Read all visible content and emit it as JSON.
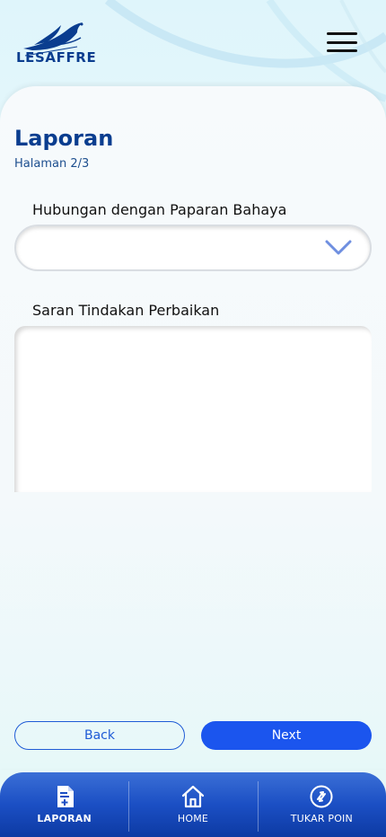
{
  "brand": {
    "name": "LESAFFRE"
  },
  "header": {
    "menu_icon": "hamburger-menu-icon"
  },
  "page": {
    "title": "Laporan",
    "subtitle": "Halaman 2/3"
  },
  "form": {
    "relation_label": "Hubungan dengan Paparan Bahaya",
    "relation_value": "",
    "suggestion_label": "Saran Tindakan Perbaikan",
    "suggestion_value": ""
  },
  "actions": {
    "back_label": "Back",
    "next_label": "Next"
  },
  "nav": {
    "items": [
      {
        "label": "LAPORAN",
        "icon": "report-add-icon",
        "active": true
      },
      {
        "label": "HOME",
        "icon": "home-icon",
        "active": false
      },
      {
        "label": "TUKAR POIN",
        "icon": "exchange-points-icon",
        "active": false
      }
    ]
  },
  "colors": {
    "primary": "#0a3d8f",
    "accent": "#1b55ee",
    "nav_bg": "#1b4fc4"
  }
}
